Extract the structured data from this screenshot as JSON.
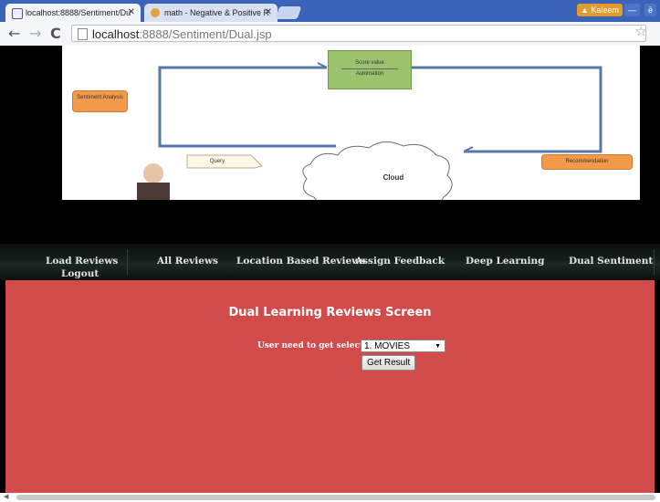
{
  "browser": {
    "tabs": [
      {
        "title": "localhost:8888/Sentiment/Du",
        "active": true
      },
      {
        "title": "math - Negative & Positive R",
        "active": false
      }
    ],
    "user_badge": "Kaleem",
    "url_host": "localhost",
    "url_rest": ":8888/Sentiment/Dual.jsp"
  },
  "banner": {
    "sentiment_analysis": "Sentiment Analysis",
    "score_value": "Score value",
    "automation": "Automation",
    "recommendation": "Recommendation",
    "cloud": "Cloud",
    "query": "Query"
  },
  "menu": {
    "items": [
      "Load Reviews",
      "All Reviews",
      "Location Based Reviews",
      "Assign Feedback",
      "Deep Learning",
      "Dual Sentiment",
      "Logout"
    ]
  },
  "main": {
    "title": "Dual Learning Reviews Screen",
    "select_label": "User need to get select",
    "select_value": "1. MOVIES",
    "submit_label": "Get Result"
  },
  "colors": {
    "content_bg": "#d14b4b",
    "menu_bg": "#14201b",
    "tab_strip": "#3b63b8"
  }
}
